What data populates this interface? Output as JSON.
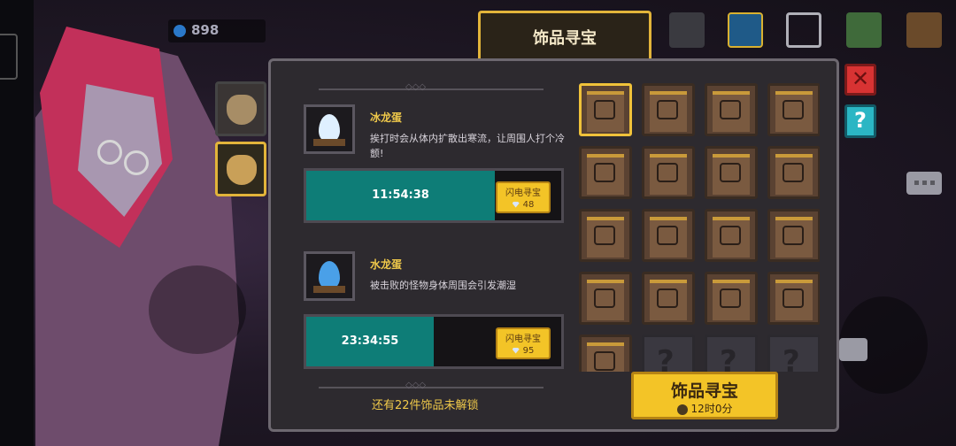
{
  "hud": {
    "coins": "898",
    "tab_title": "饰品寻宝"
  },
  "active_eggs": [
    {
      "name": "冰龙蛋",
      "description": "挨打时会从体内扩散出寒流，让周围人打个冷颤!",
      "timer": "11:54:38",
      "progress": 0.74,
      "flash_label": "闪电寻宝",
      "flash_cost": "48",
      "egg_color": "#dff0ff"
    },
    {
      "name": "水龙蛋",
      "description": "被击败的怪物身体周围会引发潮湿",
      "timer": "23:34:55",
      "progress": 0.5,
      "flash_label": "闪电寻宝",
      "flash_cost": "95",
      "egg_color": "#4aa0e8"
    }
  ],
  "locked_text": "还有22件饰品未解锁",
  "treasure_button": {
    "label": "饰品寻宝",
    "time": "12时0分"
  },
  "grid": {
    "selected_index": 0,
    "items": [
      "unlocked",
      "unlocked",
      "unlocked",
      "unlocked",
      "unlocked",
      "unlocked",
      "unlocked",
      "unlocked",
      "unlocked",
      "unlocked",
      "unlocked",
      "unlocked",
      "unlocked",
      "unlocked",
      "unlocked",
      "unlocked",
      "unlocked",
      "locked",
      "locked",
      "locked"
    ]
  },
  "icons": {
    "close": "close-icon",
    "help": "help-icon",
    "chat": "chat-icon"
  },
  "colors": {
    "accent": "#f3c427",
    "progress": "#0e7d77",
    "close": "#d83333",
    "help": "#2bb6c4"
  }
}
